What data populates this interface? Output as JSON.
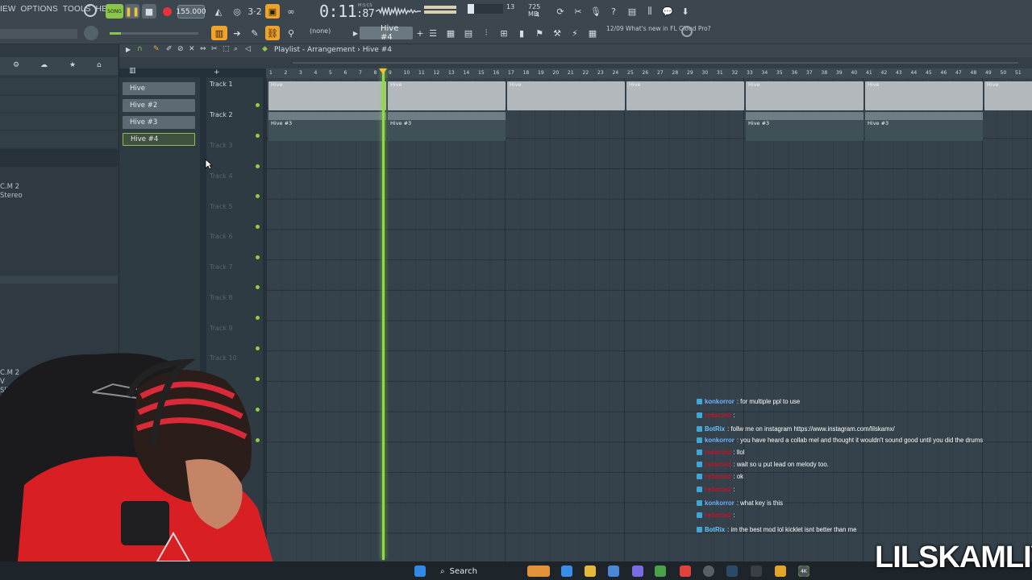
{
  "menu": [
    "IEW",
    "OPTIONS",
    "TOOLS",
    "HELP"
  ],
  "transport": {
    "tempo": "155.000",
    "time_main": "0:11",
    "time_frac": "87",
    "time_label": "M:S:CS"
  },
  "cpu": {
    "value": "13",
    "memory": "725 MB",
    "poly": "4"
  },
  "pattern_selector": "Hive #4",
  "snap": "(none)",
  "news": {
    "date": "12/09",
    "text": "What's new in FL Cloud Pro?"
  },
  "playlist": {
    "title": "Playlist - Arrangement",
    "pattern": "Hive #4"
  },
  "browser": {
    "label1": "C.M 2",
    "label1b": "Stereo",
    "label2": "C.M 2",
    "label2b": "V",
    "label2c": "Slice"
  },
  "patterns": [
    "Hive",
    "Hive #2",
    "Hive #3",
    "Hive #4"
  ],
  "tracks": [
    "Track 1",
    "Track 2",
    "Track 3",
    "Track 4",
    "Track 5",
    "Track 6",
    "Track 7",
    "Track 8",
    "Track 9",
    "Track 10"
  ],
  "ruler": [
    "1",
    "2",
    "3",
    "4",
    "5",
    "6",
    "7",
    "8",
    "9",
    "10",
    "11",
    "12",
    "13",
    "14",
    "15",
    "16",
    "17",
    "18",
    "19",
    "20",
    "21",
    "22",
    "23",
    "24",
    "25",
    "26",
    "27",
    "28",
    "29",
    "30",
    "31",
    "32",
    "33",
    "34",
    "35",
    "36",
    "37",
    "38",
    "39",
    "40",
    "41",
    "42",
    "43",
    "44",
    "45",
    "46",
    "47",
    "48",
    "49",
    "50",
    "51"
  ],
  "clips_track1": [
    "Hive",
    "Hive",
    "Hive",
    "Hive",
    "Hive",
    "Hive",
    "Hive"
  ],
  "clips_track2": [
    "Hive #3",
    "Hive #3",
    "Hive #3",
    "Hive #3"
  ],
  "chat": [
    {
      "user": "konkorror",
      "text": ": for multiple ppl to use",
      "color": "#6fb3ff"
    },
    {
      "user": "redacted",
      "text": ":",
      "color": "#c0142a"
    },
    {
      "user": "BotRix",
      "text": ": follw me on instagram https://www.instagram.com/lilskamx/",
      "color": "#61c5ff"
    },
    {
      "user": "konkorror",
      "text": ": you have heard a collab mel and thought it wouldn't sound good until you did the drums",
      "color": "#6fb3ff"
    },
    {
      "user": "redacted",
      "text": ": llol",
      "color": "#c0142a"
    },
    {
      "user": "redacted",
      "text": ": wait so u put lead on melody too.",
      "color": "#c0142a"
    },
    {
      "user": "redacted",
      "text": ": ok",
      "color": "#c0142a"
    },
    {
      "user": "redacted",
      "text": ":",
      "color": "#c0142a"
    },
    {
      "user": "konkorror",
      "text": ": what key is this",
      "color": "#6fb3ff"
    },
    {
      "user": "redacted",
      "text": ":",
      "color": "#c0142a"
    },
    {
      "user": "BotRix",
      "text": ": im the best mod lol kicklet isnt better than me",
      "color": "#61c5ff"
    }
  ],
  "taskbar": {
    "search": "Search",
    "badge": "4K"
  },
  "brand": "LILSKAMLIVE"
}
